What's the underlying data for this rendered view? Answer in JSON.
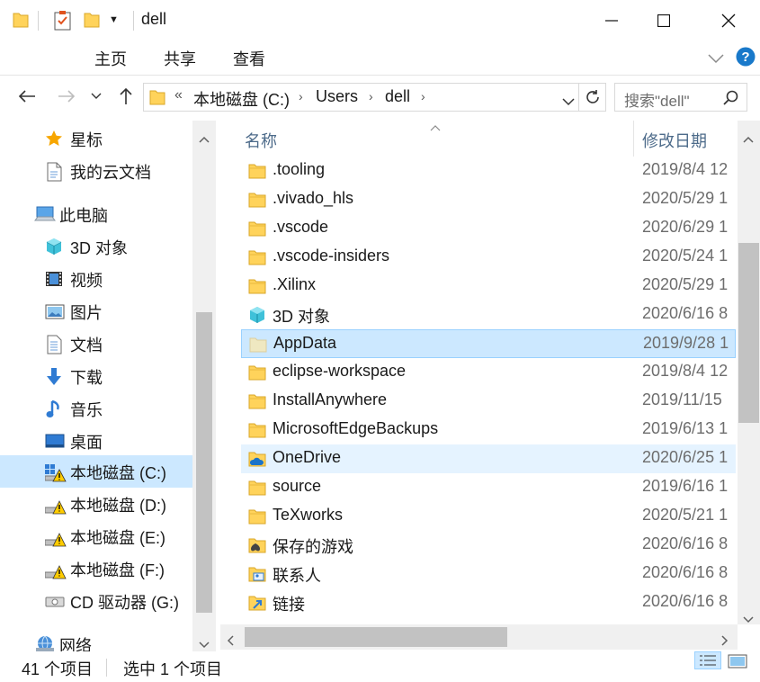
{
  "window": {
    "title": "dell"
  },
  "ribbon": {
    "tabs": [
      "主页",
      "共享",
      "查看"
    ]
  },
  "address": {
    "overflow": "«",
    "segments": [
      "本地磁盘 (C:)",
      "Users",
      "dell"
    ]
  },
  "search": {
    "placeholder": "搜索\"dell\""
  },
  "navpane": {
    "items": [
      {
        "label": "星标",
        "icon": "star-icon"
      },
      {
        "label": "我的云文档",
        "icon": "cloud-doc-icon"
      },
      {
        "label": "此电脑",
        "icon": "this-pc-icon"
      },
      {
        "label": "3D 对象",
        "icon": "3d-objects-icon"
      },
      {
        "label": "视频",
        "icon": "video-icon"
      },
      {
        "label": "图片",
        "icon": "pictures-icon"
      },
      {
        "label": "文档",
        "icon": "documents-icon"
      },
      {
        "label": "下载",
        "icon": "download-icon"
      },
      {
        "label": "音乐",
        "icon": "music-icon"
      },
      {
        "label": "桌面",
        "icon": "desktop-icon"
      },
      {
        "label": "本地磁盘 (C:)",
        "icon": "drive-c-icon"
      },
      {
        "label": "本地磁盘 (D:)",
        "icon": "drive-icon"
      },
      {
        "label": "本地磁盘 (E:)",
        "icon": "drive-icon"
      },
      {
        "label": "本地磁盘 (F:)",
        "icon": "drive-icon"
      },
      {
        "label": "CD 驱动器 (G:)",
        "icon": "cd-drive-icon"
      },
      {
        "label": "网络",
        "icon": "network-icon"
      }
    ]
  },
  "filelist": {
    "columns": {
      "name": "名称",
      "date": "修改日期"
    },
    "rows": [
      {
        "name": ".tooling",
        "date": "2019/8/4 12",
        "icon": "folder-icon"
      },
      {
        "name": ".vivado_hls",
        "date": "2020/5/29 1",
        "icon": "folder-icon"
      },
      {
        "name": ".vscode",
        "date": "2020/6/29 1",
        "icon": "folder-icon"
      },
      {
        "name": ".vscode-insiders",
        "date": "2020/5/24 1",
        "icon": "folder-icon"
      },
      {
        "name": ".Xilinx",
        "date": "2020/5/29 1",
        "icon": "folder-icon"
      },
      {
        "name": "3D 对象",
        "date": "2020/6/16 8",
        "icon": "3d-objects-icon"
      },
      {
        "name": "AppData",
        "date": "2019/9/28 1",
        "icon": "folder-hidden-icon"
      },
      {
        "name": "eclipse-workspace",
        "date": "2019/8/4 12",
        "icon": "folder-icon"
      },
      {
        "name": "InstallAnywhere",
        "date": "2019/11/15",
        "icon": "folder-icon"
      },
      {
        "name": "MicrosoftEdgeBackups",
        "date": "2019/6/13 1",
        "icon": "folder-icon"
      },
      {
        "name": "OneDrive",
        "date": "2020/6/25 1",
        "icon": "onedrive-icon"
      },
      {
        "name": "source",
        "date": "2019/6/16 1",
        "icon": "folder-icon"
      },
      {
        "name": "TeXworks",
        "date": "2020/5/21 1",
        "icon": "folder-icon"
      },
      {
        "name": "保存的游戏",
        "date": "2020/6/16 8",
        "icon": "saved-games-icon"
      },
      {
        "name": "联系人",
        "date": "2020/6/16 8",
        "icon": "contacts-icon"
      },
      {
        "name": "链接",
        "date": "2020/6/16 8",
        "icon": "links-icon"
      }
    ]
  },
  "status": {
    "count": "41 个项目",
    "selected": "选中 1 个项目"
  },
  "colors": {
    "selected_bg": "#cce8ff",
    "hover_bg": "#e5f3ff",
    "folder_yellow": "#ffd35b",
    "help_blue": "#1979ca"
  }
}
